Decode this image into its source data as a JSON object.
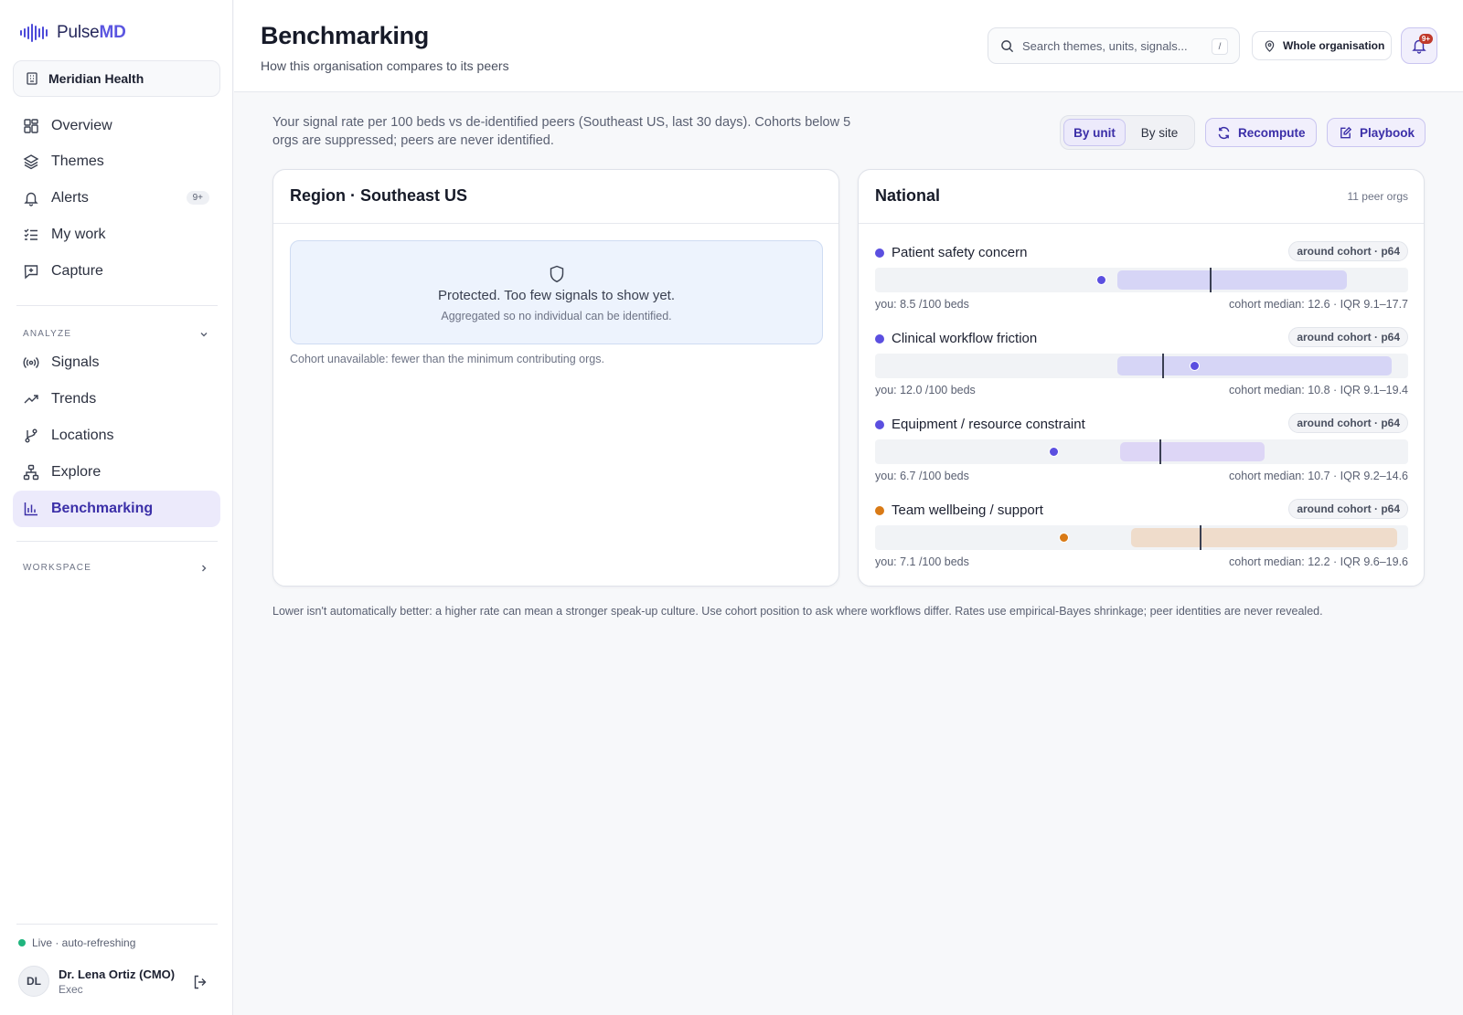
{
  "app": {
    "brand_prefix": "Pulse",
    "brand_suffix": "MD"
  },
  "sidebar": {
    "org": "Meridian Health",
    "nav": [
      {
        "label": "Overview",
        "icon": "grid-icon"
      },
      {
        "label": "Themes",
        "icon": "layers-icon"
      },
      {
        "label": "Alerts",
        "icon": "bell-icon",
        "badge": "9+"
      },
      {
        "label": "My work",
        "icon": "checklist-icon"
      },
      {
        "label": "Capture",
        "icon": "plus-message-icon"
      }
    ],
    "analyze_label": "ANALYZE",
    "analyze": [
      {
        "label": "Signals",
        "icon": "broadcast-icon"
      },
      {
        "label": "Trends",
        "icon": "trending-up-icon"
      },
      {
        "label": "Locations",
        "icon": "branch-icon"
      },
      {
        "label": "Explore",
        "icon": "network-icon"
      },
      {
        "label": "Benchmarking",
        "icon": "bar-chart-icon",
        "active": true
      }
    ],
    "workspace_label": "WORKSPACE",
    "live": "Live · auto-refreshing",
    "user": {
      "initials": "DL",
      "name": "Dr. Lena Ortiz (CMO)",
      "role": "Exec"
    }
  },
  "header": {
    "title": "Benchmarking",
    "subtitle": "How this organisation compares to its peers",
    "search_placeholder": "Search themes, units, signals...",
    "search_shortcut": "/",
    "scope": "Whole organisation",
    "notifications_badge": "9+"
  },
  "main": {
    "intro": "Your signal rate per 100 beds vs de-identified peers (Southeast US, last 30 days). Cohorts below 5 orgs are suppressed; peers are never identified.",
    "toggle": {
      "by_unit": "By unit",
      "by_site": "By site",
      "selected": "By unit"
    },
    "recompute_label": "Recompute",
    "playbook_label": "Playbook",
    "region_card": {
      "title": "Region · Southeast US",
      "protected_title": "Protected. Too few signals to show yet.",
      "protected_sub": "Aggregated so no individual can be identified.",
      "note": "Cohort unavailable: fewer than the minimum contributing orgs."
    },
    "national_card": {
      "title": "National",
      "peer_orgs": "11 peer orgs",
      "scale_max": 20,
      "metrics": [
        {
          "name": "Patient safety concern",
          "tag": "around cohort · p64",
          "you": 8.5,
          "median": 12.6,
          "iqr": [
            9.1,
            17.7
          ],
          "you_label": "you: 8.5 /100 beds",
          "cohort_label": "cohort median: 12.6 · IQR 9.1–17.7",
          "color": "#5b4fe0",
          "band": "#d6d5f6"
        },
        {
          "name": "Clinical workflow friction",
          "tag": "around cohort · p64",
          "you": 12.0,
          "median": 10.8,
          "iqr": [
            9.1,
            19.4
          ],
          "you_label": "you: 12.0 /100 beds",
          "cohort_label": "cohort median: 10.8 · IQR 9.1–19.4",
          "color": "#5b4fe0",
          "band": "#d6d5f6"
        },
        {
          "name": "Equipment / resource constraint",
          "tag": "around cohort · p64",
          "you": 6.7,
          "median": 10.7,
          "iqr": [
            9.2,
            14.6
          ],
          "you_label": "you: 6.7 /100 beds",
          "cohort_label": "cohort median: 10.7 · IQR 9.2–14.6",
          "color": "#5b4fe0",
          "band": "#ddd6f6"
        },
        {
          "name": "Team wellbeing / support",
          "tag": "around cohort · p64",
          "you": 7.1,
          "median": 12.2,
          "iqr": [
            9.6,
            19.6
          ],
          "you_label": "you: 7.1 /100 beds",
          "cohort_label": "cohort median: 12.2 · IQR 9.6–19.6",
          "color": "#d97a16",
          "band": "#efdccb"
        }
      ]
    },
    "footnote": "Lower isn't automatically better: a higher rate can mean a stronger speak-up culture. Use cohort position to ask where workflows differ. Rates use empirical-Bayes shrinkage; peer identities are never revealed."
  }
}
